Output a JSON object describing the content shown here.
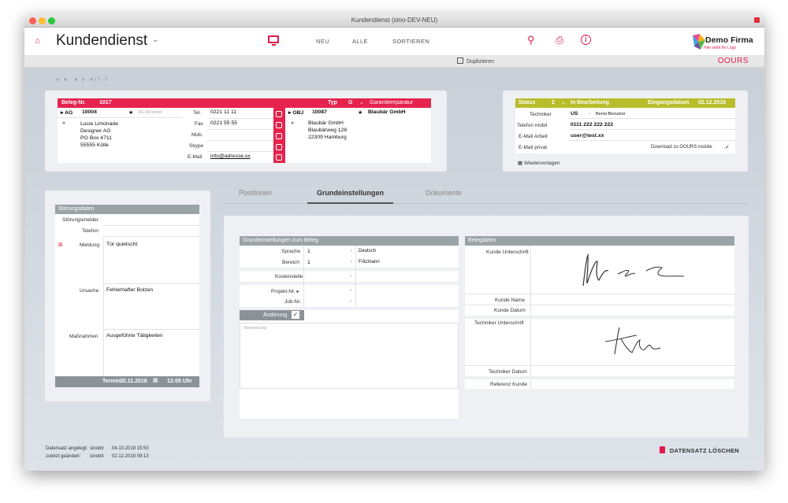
{
  "window": {
    "title": "Kundendienst (sino-DEV-NEU)"
  },
  "toolbar": {
    "app_title": "Kundendienst",
    "nav": [
      "NEU",
      "ALLE",
      "SORTIEREN"
    ],
    "logo_text": "Demo Firma",
    "logo_sub": "Hier steht Ihr Logo"
  },
  "subbar": {
    "duplicate_label": "Duplizieren",
    "brand": "OOURS"
  },
  "pager": {
    "position": "4 / 7 - 7"
  },
  "beleg": {
    "header_label": "Beleg-Nr.",
    "number": "1017",
    "typ_label": "Typ",
    "typ_value": "G",
    "typ_desc": "Garantiereparatur",
    "ag_label": "AG",
    "ag_number": "10004",
    "ag_partner": "AG APartner",
    "ag_address": [
      "Lucie Limonade",
      "Designer AG",
      "PO Box 4711",
      "55555 Kölle"
    ],
    "contacts": [
      {
        "label": "Tel.",
        "value": "0221 11 11"
      },
      {
        "label": "Fax",
        "value": "0221 55 55"
      },
      {
        "label": "Mob.",
        "value": ""
      },
      {
        "label": "Skype",
        "value": ""
      },
      {
        "label": "E-Mail",
        "value": "info@adresse.xx"
      }
    ],
    "obj_label": "OBJ",
    "obj_number": "10087",
    "obj_name": "Blaubär GmbH",
    "obj_address": [
      "Blaubär GmbH",
      "Blaubärweg 128",
      "22309 Hamburg"
    ]
  },
  "status": {
    "label": "Status",
    "code": "2",
    "text": "In Bearbeitung",
    "date_label": "Eingangsdatum",
    "date": "02.12.2018",
    "rows": [
      {
        "label": "Techniker",
        "value": "US",
        "extra": "Benni Benutzer"
      },
      {
        "label": "Telefon mobil",
        "value": "0111 222 222 222",
        "extra": ""
      },
      {
        "label": "E-Mail Arbeit",
        "value": "user@test.xx",
        "extra": ""
      },
      {
        "label": "E-Mail privat",
        "value": "",
        "extra": "Download zu OOURS mobile"
      }
    ],
    "checkmark": "✓",
    "wiedervorlagen": "Wiedervorlagen"
  },
  "stoerung": {
    "title": "Störungsdaten",
    "rows": [
      {
        "label": "Störungsmelder",
        "value": ""
      },
      {
        "label": "Telefon",
        "value": ""
      }
    ],
    "big": [
      {
        "label": "Meldung",
        "value": "Tür quietscht"
      },
      {
        "label": "Ursache",
        "value": "Fehlerhafter Bolzen"
      },
      {
        "label": "Maßnahmen",
        "value": "Ausgeführte Tätigkeiten"
      }
    ],
    "termin_label": "Termin",
    "termin_date": "30.11.2018",
    "termin_time": "12:00 Uhr"
  },
  "tabs": [
    "Positionen",
    "Grundeinstellungen",
    "Dokumente"
  ],
  "grund": {
    "title": "Grundeinstellungen zum Beleg",
    "rows": [
      {
        "label": "Sprache",
        "value": "1",
        "extra": "Deutsch"
      },
      {
        "label": "Bereich",
        "value": "1",
        "extra": "Fritzmann"
      },
      {
        "label": "Kostenstelle",
        "value": "",
        "extra": ""
      },
      {
        "label": "Projekt-Nr.",
        "value": "",
        "extra": ""
      },
      {
        "label": "Job-Nr.",
        "value": "",
        "extra": ""
      }
    ],
    "aenderung": "Änderung",
    "bemerkung_placeholder": "Bemerkung"
  },
  "belegdaten": {
    "title": "Belegdaten",
    "labels": [
      "Kunde Unterschrift",
      "Kunde Name",
      "Kunde Datum",
      "Techniker Unterschrift",
      "Techniker Datum",
      "Referenz Kunde"
    ]
  },
  "footer": {
    "created_label": "Datensatz angelegt:",
    "created_user": "sinobit",
    "created_at": "04.10.2018 15:50",
    "changed_label": "zuletzt geändert:",
    "changed_user": "sinobit",
    "changed_at": "02.12.2018 09:13",
    "delete_label": "DATENSATZ LÖSCHEN"
  },
  "colors": {
    "accent": "#e5234d",
    "status": "#b9bd2a",
    "grey_header": "#9aa3a6"
  }
}
